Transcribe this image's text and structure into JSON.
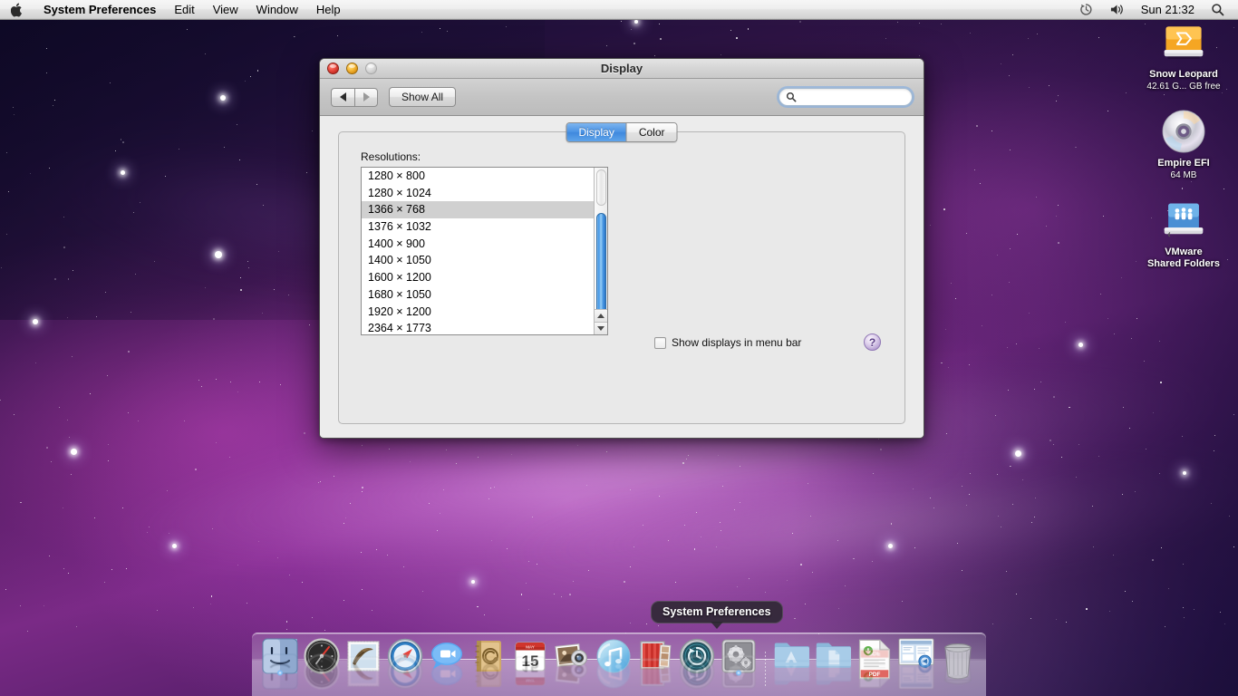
{
  "menubar": {
    "apple_icon": "apple-logo-icon",
    "app_name": "System Preferences",
    "items": [
      "Edit",
      "View",
      "Window",
      "Help"
    ],
    "status": {
      "timemachine_icon": "time-machine-icon",
      "volume_icon": "volume-speaker-icon",
      "clock": "Sun 21:32",
      "spotlight_icon": "spotlight-search-icon"
    }
  },
  "desktop_icons": [
    {
      "name": "Snow Leopard",
      "sub": "42.61 G... GB free",
      "icon": "hard-drive-icon"
    },
    {
      "name": "Empire EFI",
      "sub": "64 MB",
      "icon": "optical-disc-icon"
    },
    {
      "name": "VMware\nShared Folders",
      "sub": "",
      "icon": "network-shared-folder-icon"
    }
  ],
  "window": {
    "title": "Display",
    "toolbar": {
      "back_icon": "back-arrow-icon",
      "forward_icon": "forward-arrow-icon",
      "show_all_label": "Show All",
      "search_icon": "search-magnifier-icon",
      "search_value": "",
      "search_placeholder": ""
    },
    "tabs": [
      {
        "label": "Display",
        "active": true
      },
      {
        "label": "Color",
        "active": false
      }
    ],
    "resolutions_label": "Resolutions:",
    "resolutions": [
      "1280 × 800",
      "1280 × 1024",
      "1366 × 768",
      "1376 × 1032",
      "1400 × 900",
      "1400 × 1050",
      "1600 × 1200",
      "1680 × 1050",
      "1920 × 1200",
      "2364 × 1773"
    ],
    "selected_resolution": "1366 × 768",
    "selected_index": 2,
    "checkbox": {
      "label": "Show displays in menu bar",
      "checked": false
    },
    "help_label": "?"
  },
  "dock": {
    "tooltip": "System Preferences",
    "items": [
      {
        "name": "Finder",
        "running": true
      },
      {
        "name": "Dashboard",
        "running": false
      },
      {
        "name": "Mail",
        "running": false
      },
      {
        "name": "Safari",
        "running": false
      },
      {
        "name": "iChat",
        "running": false
      },
      {
        "name": "Address Book",
        "running": false
      },
      {
        "name": "iCal",
        "running": false
      },
      {
        "name": "iPhoto",
        "running": false
      },
      {
        "name": "iTunes",
        "running": false
      },
      {
        "name": "Photo Booth",
        "running": false
      },
      {
        "name": "Time Machine",
        "running": false
      },
      {
        "name": "System Preferences",
        "running": true
      }
    ],
    "folders": [
      {
        "name": "Applications"
      },
      {
        "name": "Documents"
      },
      {
        "name": "PDF Document"
      },
      {
        "name": "Screenshot"
      }
    ],
    "trash": {
      "name": "Trash"
    }
  },
  "colors": {
    "accent_blue": "#3f88dd",
    "selection_gray": "#d0d0d0",
    "window_bg": "#ececec",
    "help_purple": "#b9a3d4"
  }
}
